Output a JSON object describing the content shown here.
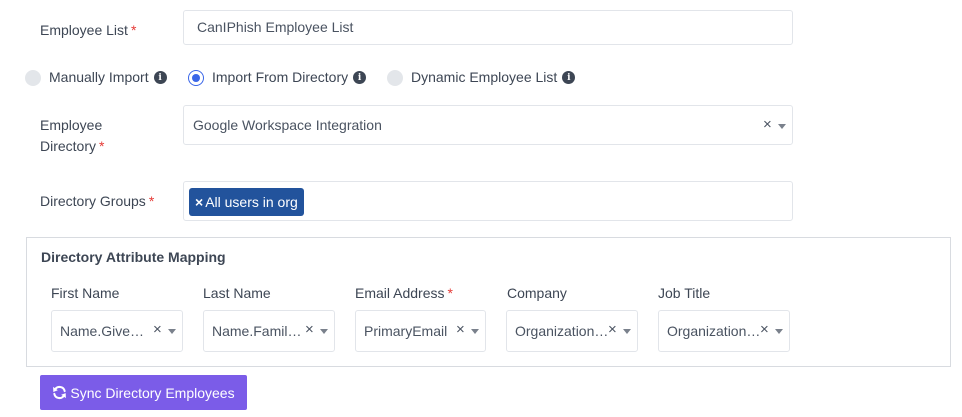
{
  "employee_list": {
    "label": "Employee List",
    "required_mark": "*",
    "value": "CanIPhish Employee List"
  },
  "import_options": [
    {
      "label": "Manually Import",
      "selected": false,
      "info_icon": "info-icon"
    },
    {
      "label": "Import From Directory",
      "selected": true,
      "info_icon": "info-icon"
    },
    {
      "label": "Dynamic Employee List",
      "selected": false,
      "info_icon": "info-icon"
    }
  ],
  "employee_directory": {
    "label_line1": "Employee",
    "label_line2": "Directory",
    "required_mark": "*",
    "value": "Google Workspace Integration",
    "clear_glyph": "×"
  },
  "directory_groups": {
    "label": "Directory Groups",
    "required_mark": "*",
    "tags": [
      {
        "remove_glyph": "×",
        "label": "All users in org"
      }
    ]
  },
  "mapping": {
    "title": "Directory Attribute Mapping",
    "columns": [
      {
        "label": "First Name",
        "required": false,
        "value": "Name.Given…"
      },
      {
        "label": "Last Name",
        "required": false,
        "value": "Name.Family…"
      },
      {
        "label": "Email Address",
        "required": true,
        "required_mark": "*",
        "value": "PrimaryEmail"
      },
      {
        "label": "Company",
        "required": false,
        "value": "Organization.…"
      },
      {
        "label": "Job Title",
        "required": false,
        "value": "Organization.…"
      }
    ],
    "clear_glyph": "×"
  },
  "sync_button": {
    "label": "Sync Directory Employees",
    "icon": "sync-icon",
    "color": "#7b5ce8"
  },
  "colors": {
    "accent": "#3a66e8",
    "tag": "#22539c",
    "required": "#e53935"
  }
}
